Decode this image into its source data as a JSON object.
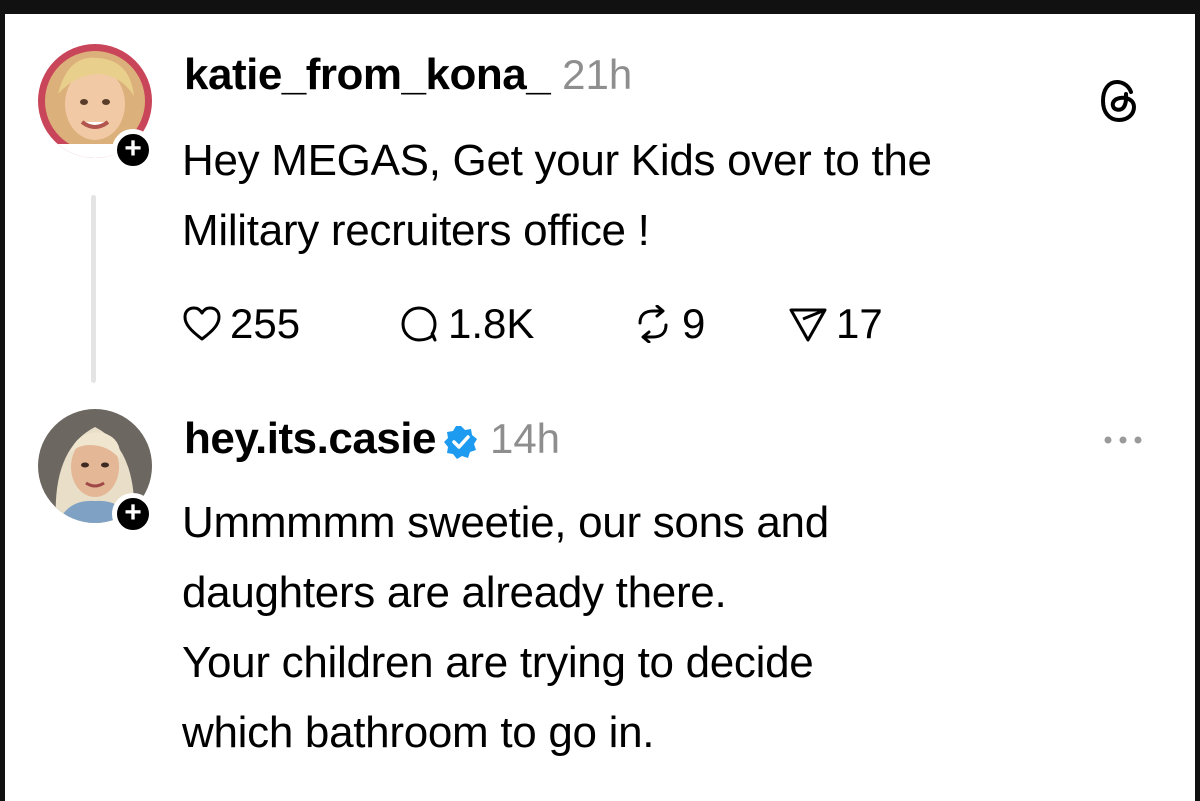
{
  "post1": {
    "username": "katie_from_kona_",
    "time": "21h",
    "text_lines": [
      "Hey MEGAS, Get your Kids over to the",
      "Military recruiters office !"
    ],
    "stats": {
      "likes": "255",
      "comments": "1.8K",
      "reposts": "9",
      "shares": "17"
    },
    "icons": {
      "app": "threads-icon",
      "follow": "plus-icon"
    }
  },
  "post2": {
    "username": "hey.its.casie",
    "verified": true,
    "time": "14h",
    "text_lines": [
      "Ummmmm sweetie, our sons and",
      "daughters are already there.",
      "Your children are trying to decide",
      "which bathroom to go in."
    ],
    "icons": {
      "menu": "more-icon",
      "follow": "plus-icon"
    }
  },
  "colors": {
    "timestamp": "#8e8e8e",
    "verified": "#1d9bf0",
    "thread_line": "#e4e4e4"
  }
}
